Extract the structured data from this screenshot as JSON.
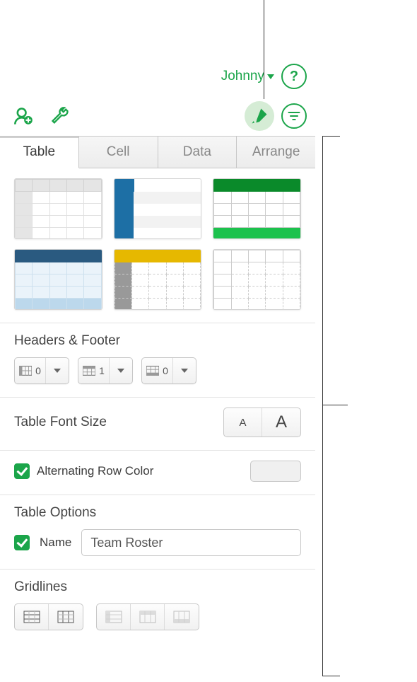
{
  "header": {
    "user_name": "Johnny"
  },
  "tabs": {
    "table": "Table",
    "cell": "Cell",
    "data": "Data",
    "arrange": "Arrange"
  },
  "headers_footer": {
    "title": "Headers & Footer",
    "header_cols": "0",
    "header_rows": "1",
    "footer_rows": "0"
  },
  "font_size": {
    "title": "Table Font Size",
    "small": "A",
    "big": "A"
  },
  "alt_row": {
    "label": "Alternating Row Color"
  },
  "table_options": {
    "title": "Table Options",
    "name_label": "Name",
    "name_value": "Team Roster"
  },
  "gridlines": {
    "title": "Gridlines"
  }
}
